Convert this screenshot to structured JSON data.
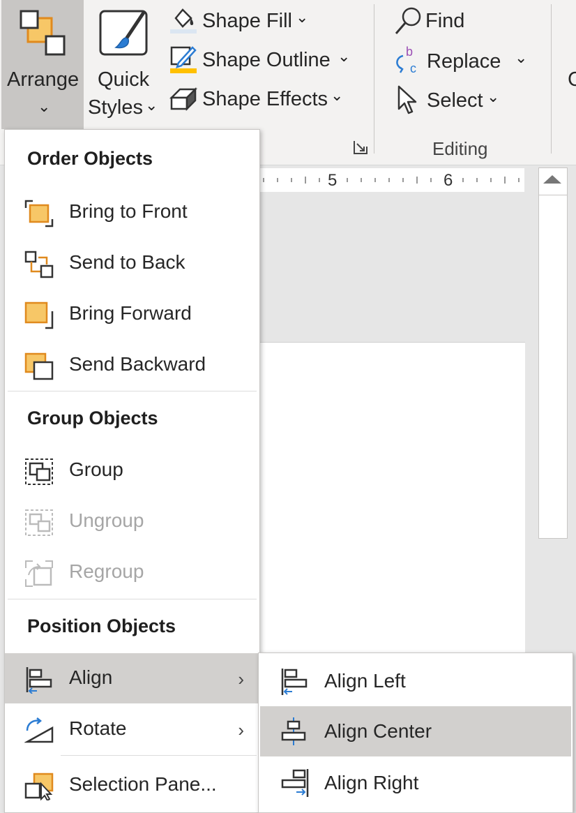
{
  "ribbon": {
    "arrange_label": "Arrange",
    "quick_styles_line1": "Quick",
    "quick_styles_line2": "Styles",
    "shape_fill": "Shape Fill",
    "shape_outline": "Shape Outline",
    "shape_effects": "Shape Effects",
    "find": "Find",
    "replace": "Replace",
    "select": "Select",
    "editing_group": "Editing",
    "cut_off_text": "C"
  },
  "ruler": {
    "ticks": [
      "5",
      "6"
    ]
  },
  "menu": {
    "order_header": "Order Objects",
    "bring_to_front": "Bring to Front",
    "send_to_back": "Send to Back",
    "bring_forward": "Bring Forward",
    "send_backward": "Send Backward",
    "group_header": "Group Objects",
    "group": "Group",
    "ungroup": "Ungroup",
    "regroup": "Regroup",
    "position_header": "Position Objects",
    "align": "Align",
    "rotate": "Rotate",
    "selection_pane": "Selection Pane..."
  },
  "submenu": {
    "align_left": "Align Left",
    "align_center": "Align Center",
    "align_right": "Align Right"
  },
  "colors": {
    "accent_orange": "#f7c767",
    "accent_orange_border": "#e08a1e",
    "accent_blue": "#2b7cd3",
    "highlight": "#d2d0ce"
  }
}
